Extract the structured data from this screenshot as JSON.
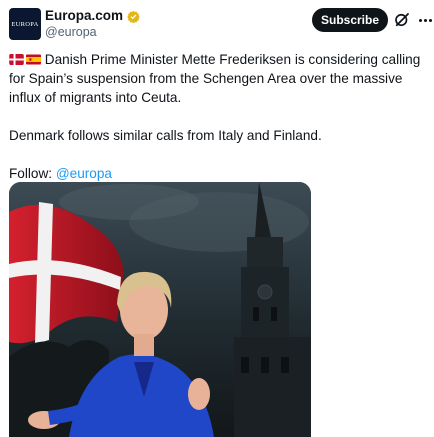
{
  "account": {
    "avatar_text": "EUROPA",
    "display_name": "Europa.com",
    "handle": "@europa"
  },
  "actions": {
    "subscribe_label": "Subscribe"
  },
  "tweet": {
    "flags": [
      "flag-denmark",
      "flag-spain"
    ],
    "line1": "Danish Prime Minister Mette Frederiksen is considering calling for Spain’s suspension from the Schengen Area over the massive influx of migrants into Ceuta.",
    "line2": "Denmark follows similar calls from Italy and Finland.",
    "follow_prefix": "Follow: ",
    "follow_mention": "@europa"
  },
  "colors": {
    "brand_dark": "#0f1419",
    "link": "#1d9bf0",
    "verified_gold": "#e2b719",
    "muted": "#536471"
  },
  "icons": [
    "verified-badge-icon",
    "grok-icon",
    "more-options-icon"
  ]
}
